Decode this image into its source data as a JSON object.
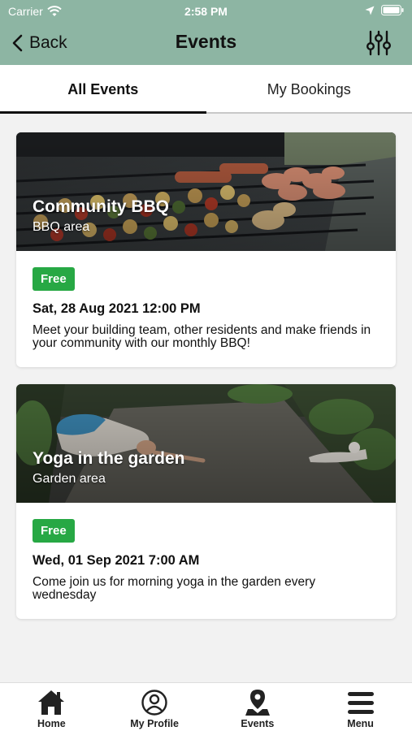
{
  "status_bar": {
    "carrier": "Carrier",
    "time": "2:58 PM"
  },
  "nav": {
    "back_label": "Back",
    "title": "Events"
  },
  "tabs": {
    "all_events": "All Events",
    "my_bookings": "My Bookings"
  },
  "events": [
    {
      "title": "Community BBQ",
      "location": "BBQ area",
      "price_badge": "Free",
      "date": "Sat, 28 Aug 2021 12:00 PM",
      "description": "Meet your building team, other residents and make friends in your community with our monthly BBQ!"
    },
    {
      "title": "Yoga in the garden",
      "location": "Garden area",
      "price_badge": "Free",
      "date": "Wed, 01 Sep 2021 7:00 AM",
      "description": "Come join us for morning yoga in the garden every wednesday"
    }
  ],
  "tab_bar": {
    "home": "Home",
    "my_profile": "My Profile",
    "events": "Events",
    "menu": "Menu"
  },
  "colors": {
    "header_green": "#8db5a3",
    "badge_green": "#27a844",
    "background": "#f2f2f2"
  },
  "icons": {
    "status": [
      "wifi-icon",
      "location-arrow-icon",
      "battery-icon"
    ],
    "nav": [
      "chevron-left-icon",
      "filter-sliders-icon"
    ],
    "tab_bar": [
      "home-icon",
      "profile-icon",
      "events-pin-icon",
      "menu-icon"
    ]
  }
}
